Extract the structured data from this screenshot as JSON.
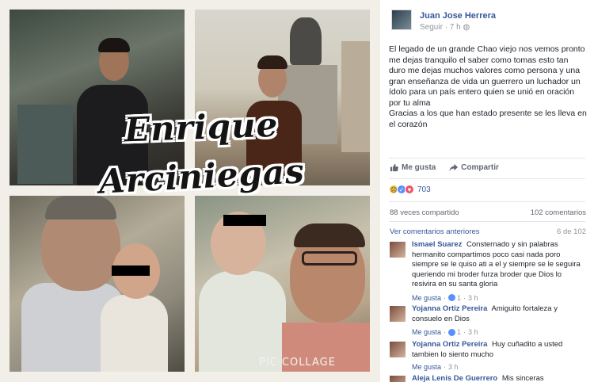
{
  "collage": {
    "title_line1": "Enrique",
    "title_line2": "Arciniegas",
    "watermark": "PIC·COLLAGE"
  },
  "post": {
    "author": "Juan Jose Herrera",
    "follow": "Seguir",
    "time": "7 h",
    "text_p1": "El legado de un grande Chao viejo nos vemos pronto me dejas tranquilo el saber como tomas esto tan duro me dejas muchos valores como persona y una gran enseñanza de vida un guerrero un luchador un ídolo para un país entero quien se unió en oración por tu alma",
    "text_p2": "Gracias a los que han estado presente se les lleva en el corazón"
  },
  "actions": {
    "like": "Me gusta",
    "share": "Compartir"
  },
  "reactions": {
    "count": "703",
    "icons": [
      "sad-icon",
      "like-icon",
      "love-icon"
    ]
  },
  "stats": {
    "shares": "88 veces compartido",
    "comments": "102 comentarios"
  },
  "comments_nav": {
    "previous": "Ver comentarios anteriores",
    "position": "6 de 102"
  },
  "comments": [
    {
      "name": "Ismael Suarez",
      "text": "Consternado y sin palabras hermanito compartimos poco casi nada poro siempre se le quiso ati a el y siempre se le seguira queriendo mi broder furza broder que Dios lo resivira en su santa gloria",
      "like": "Me gusta",
      "likes": "1",
      "time": "3 h"
    },
    {
      "name": "Yojanna Ortiz Pereira",
      "text": "Amiguito fortaleza y consuelo en Dios",
      "like": "Me gusta",
      "likes": "1",
      "time": "3 h"
    },
    {
      "name": "Yojanna Ortiz Pereira",
      "text": "Huy cuñadito a usted tambien lo siento mucho",
      "like": "Me gusta",
      "likes": "",
      "time": "3 h"
    },
    {
      "name": "Aleja Lenis De Guerrero",
      "text": "Mis sinceras",
      "like": "",
      "likes": "",
      "time": ""
    }
  ],
  "colors": {
    "link": "#365899",
    "muted": "#90949c",
    "text": "#1d2129"
  }
}
